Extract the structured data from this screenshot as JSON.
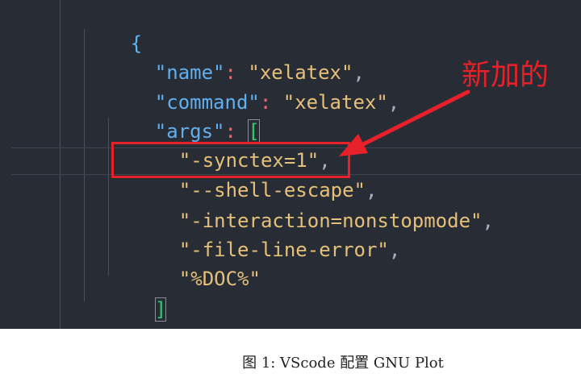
{
  "editor": {
    "lines": {
      "open_brace": "{",
      "name_key": "\"name\"",
      "name_colon": ":",
      "name_value": "\"xelatex\"",
      "name_comma": ",",
      "command_key": "\"command\"",
      "command_colon": ":",
      "command_value": "\"xelatex\"",
      "command_comma": ",",
      "args_key": "\"args\"",
      "args_colon": ":",
      "args_open": "[",
      "arg1_value": "\"-synctex=1\"",
      "arg1_comma": ",",
      "arg2_value": "\"--shell-escape\"",
      "arg2_comma": ",",
      "arg3_value": "\"-interaction=nonstopmode\"",
      "arg3_comma": ",",
      "arg4_value": "\"-file-line-error\"",
      "arg4_comma": ",",
      "arg5_value": "\"%DOC%\"",
      "args_close": "]",
      "close_brace": "}",
      "close_comma": ","
    }
  },
  "annotation": {
    "text": "新加的",
    "color": "#e8202a"
  },
  "caption": {
    "text": "图 1: VScode 配置 GNU Plot"
  }
}
